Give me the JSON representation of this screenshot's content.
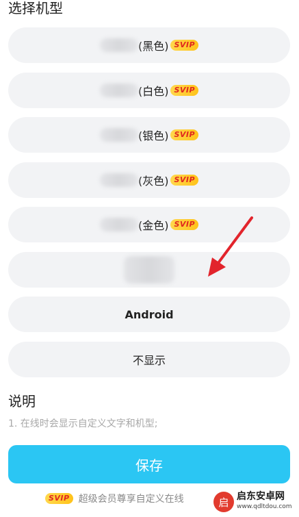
{
  "section": {
    "model_title": "选择机型",
    "desc_title": "说明"
  },
  "badge": {
    "svip": "SVIP"
  },
  "options": [
    {
      "label": "(黑色)",
      "svip": true
    },
    {
      "label": "(白色)",
      "svip": true
    },
    {
      "label": "(银色)",
      "svip": true
    },
    {
      "label": "(灰色)",
      "svip": true
    },
    {
      "label": "(金色)",
      "svip": true
    },
    {
      "label": "",
      "svip": false
    },
    {
      "label": "Android",
      "svip": false
    },
    {
      "label": "不显示",
      "svip": false
    }
  ],
  "description": {
    "line1": "1. 在线时会显示自定义文字和机型;"
  },
  "save_button": {
    "label": "保存"
  },
  "footer": {
    "text": "超级会员尊享自定义在线"
  },
  "watermark": {
    "logo": "启",
    "title": "启东安卓网",
    "url": "www.qdltdou.com"
  },
  "colors": {
    "accent": "#2bc6f3",
    "arrow": "#e2242c",
    "badge_bg": "#ffc21a",
    "badge_text": "#e0281f"
  }
}
